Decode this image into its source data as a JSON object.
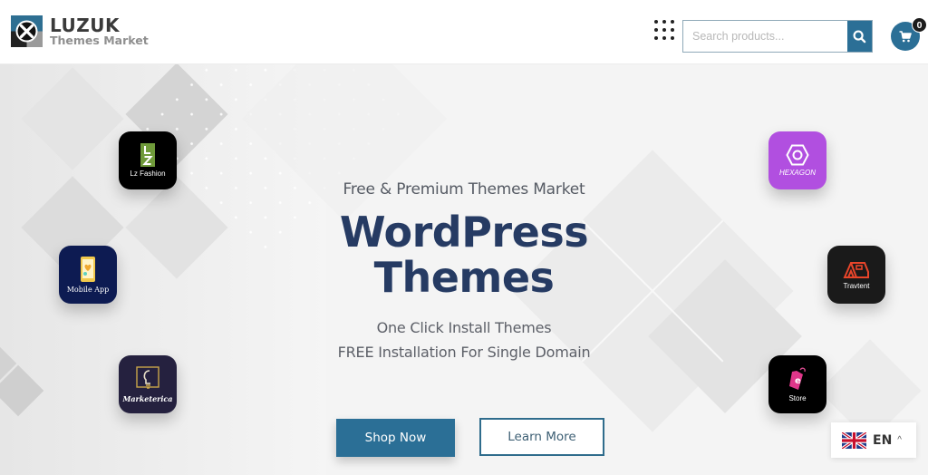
{
  "brand": {
    "title": "LUZUK",
    "subtitle": "Themes Market",
    "accent": "#2b6f96",
    "headline_color": "#263b63"
  },
  "header": {
    "apps_icon": "grid-dots-icon",
    "search": {
      "placeholder": "Search products...",
      "value": "",
      "button_icon": "search-icon"
    },
    "cart": {
      "icon": "shopping-cart-icon",
      "count": "0"
    }
  },
  "hero": {
    "kicker": "Free & Premium Themes Market",
    "headline_line1": "WordPress",
    "headline_line2": "Themes",
    "sub_line1": "One Click Install Themes",
    "sub_line2": "FREE Installation For Single Domain",
    "primary_button": "Shop Now",
    "secondary_button": "Learn More"
  },
  "apps": [
    {
      "label": "Lz Fashion",
      "icon": "lz-fashion-logo-icon",
      "bg": "#000000"
    },
    {
      "label": "Mobile App",
      "icon": "mobile-phone-icon",
      "bg": "#0d1b52"
    },
    {
      "label": "Marketerica",
      "icon": "lightbulb-icon",
      "bg": "#25213f"
    },
    {
      "label": "HEXAGON",
      "icon": "hexagon-icon",
      "bg": "#b14fe0"
    },
    {
      "label": "Travtent",
      "icon": "tent-icon",
      "bg": "#1a1a1a"
    },
    {
      "label": "Store",
      "icon": "price-tag-icon",
      "bg": "#000000"
    }
  ],
  "language": {
    "code": "EN",
    "flag": "uk-flag-icon",
    "caret": "^"
  }
}
